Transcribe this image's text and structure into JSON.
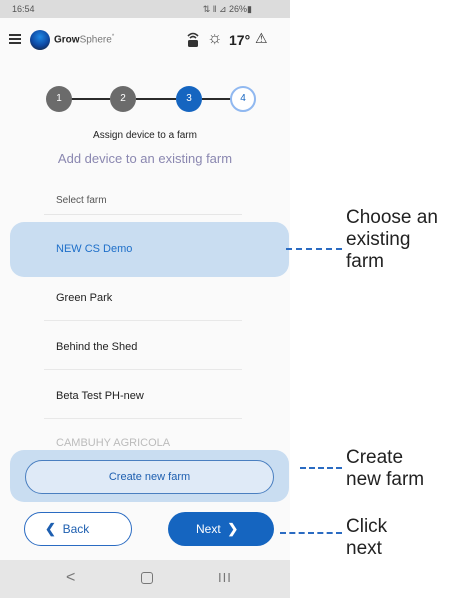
{
  "status_bar": {
    "time": "16:54",
    "indicators": "⇅ ‖ ⊿ 26%▮"
  },
  "app_bar": {
    "brand_bold": "Grow",
    "brand_light": "Sphere",
    "brand_mark": "*",
    "temperature": "17°",
    "icons": [
      "menu-icon",
      "globe-logo",
      "router-icon",
      "sun-icon",
      "warning-icon"
    ]
  },
  "stepper": {
    "steps": [
      {
        "label": "1",
        "state": "done"
      },
      {
        "label": "2",
        "state": "done"
      },
      {
        "label": "3",
        "state": "active"
      },
      {
        "label": "4",
        "state": "todo"
      }
    ]
  },
  "headings": {
    "title": "Assign device to a farm",
    "subtitle": "Add device to an existing farm"
  },
  "select": {
    "label": "Select farm"
  },
  "farms": [
    {
      "name": "NEW CS Demo",
      "selected": true
    },
    {
      "name": "Green Park",
      "selected": false
    },
    {
      "name": "Behind the Shed",
      "selected": false
    },
    {
      "name": "Beta Test PH-new",
      "selected": false
    },
    {
      "name": "CAMBUHY AGRICOLA",
      "selected": false
    }
  ],
  "buttons": {
    "create": "Create new farm",
    "back": "Back",
    "next": "Next",
    "back_chevron": "❮",
    "next_chevron": "❯"
  },
  "android_nav": {
    "back": "<",
    "recent": "III"
  },
  "callouts": {
    "choose": [
      "Choose an",
      "existing",
      "farm"
    ],
    "create": [
      "Create",
      "new farm"
    ],
    "next": [
      "Click",
      "next"
    ]
  },
  "colors": {
    "primary": "#1565c0",
    "highlight": "#c9ddf1",
    "callout_line": "#2a6bc2"
  }
}
